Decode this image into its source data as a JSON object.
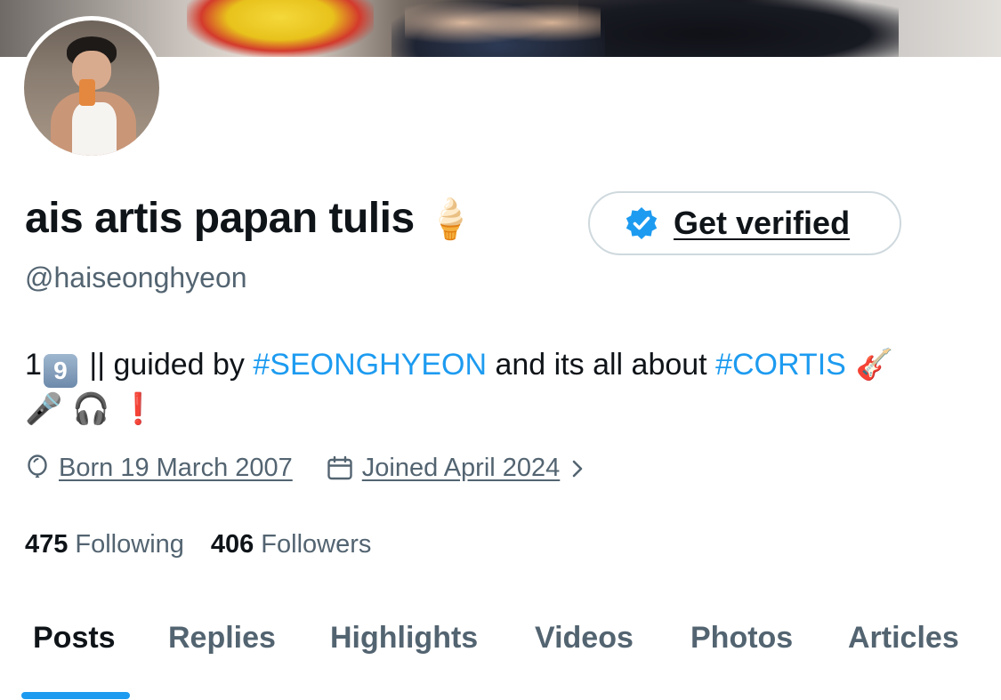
{
  "profile": {
    "display_name": "ais artis papan tulis",
    "name_emoji": "🍦",
    "handle": "@haiseonghyeon",
    "verify_button_label": "Get verified"
  },
  "bio": {
    "prefix": "1",
    "keycap": "9",
    "text_a": " || guided by ",
    "tag_1": "#SEONGHYEON",
    "text_b": " and its all about ",
    "tag_2": "#CORTIS",
    "emojis_line1": " 🎸",
    "emojis_line2": "🎤 🎧 ❗"
  },
  "meta": {
    "born": "Born 19 March 2007",
    "joined": "Joined April 2024"
  },
  "stats": {
    "following_count": "475",
    "following_label": "Following",
    "followers_count": "406",
    "followers_label": "Followers"
  },
  "tabs": [
    {
      "label": "Posts",
      "active": true
    },
    {
      "label": "Replies",
      "active": false
    },
    {
      "label": "Highlights",
      "active": false
    },
    {
      "label": "Videos",
      "active": false
    },
    {
      "label": "Photos",
      "active": false
    },
    {
      "label": "Articles",
      "active": false
    }
  ],
  "colors": {
    "accent": "#1d9bf0",
    "secondary_text": "#536471",
    "primary_text": "#0f1419"
  }
}
